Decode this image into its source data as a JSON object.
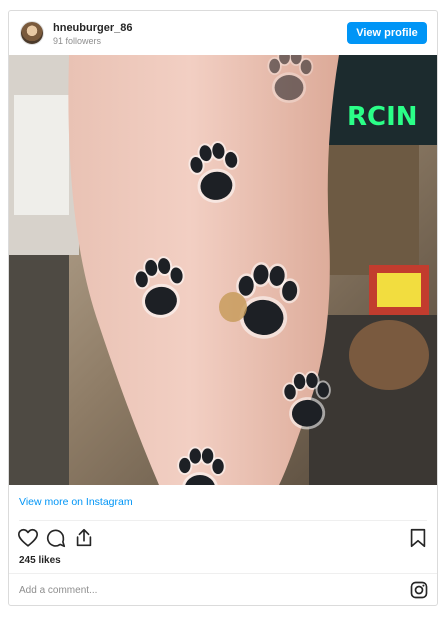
{
  "post": {
    "username": "hneuburger_86",
    "followers": "91 followers",
    "view_profile_label": "View profile",
    "view_more_label": "View more on Instagram",
    "likes": "245 likes",
    "comment_placeholder": "Add a comment...",
    "neon_sign_text": "RCIN"
  },
  "colors": {
    "accent": "#0095f6",
    "border": "#dbdbdb",
    "muted": "#8e8e8e",
    "neon": "#2bff88"
  },
  "icons": [
    "heart-icon",
    "comment-icon",
    "share-icon",
    "bookmark-icon",
    "instagram-icon"
  ]
}
